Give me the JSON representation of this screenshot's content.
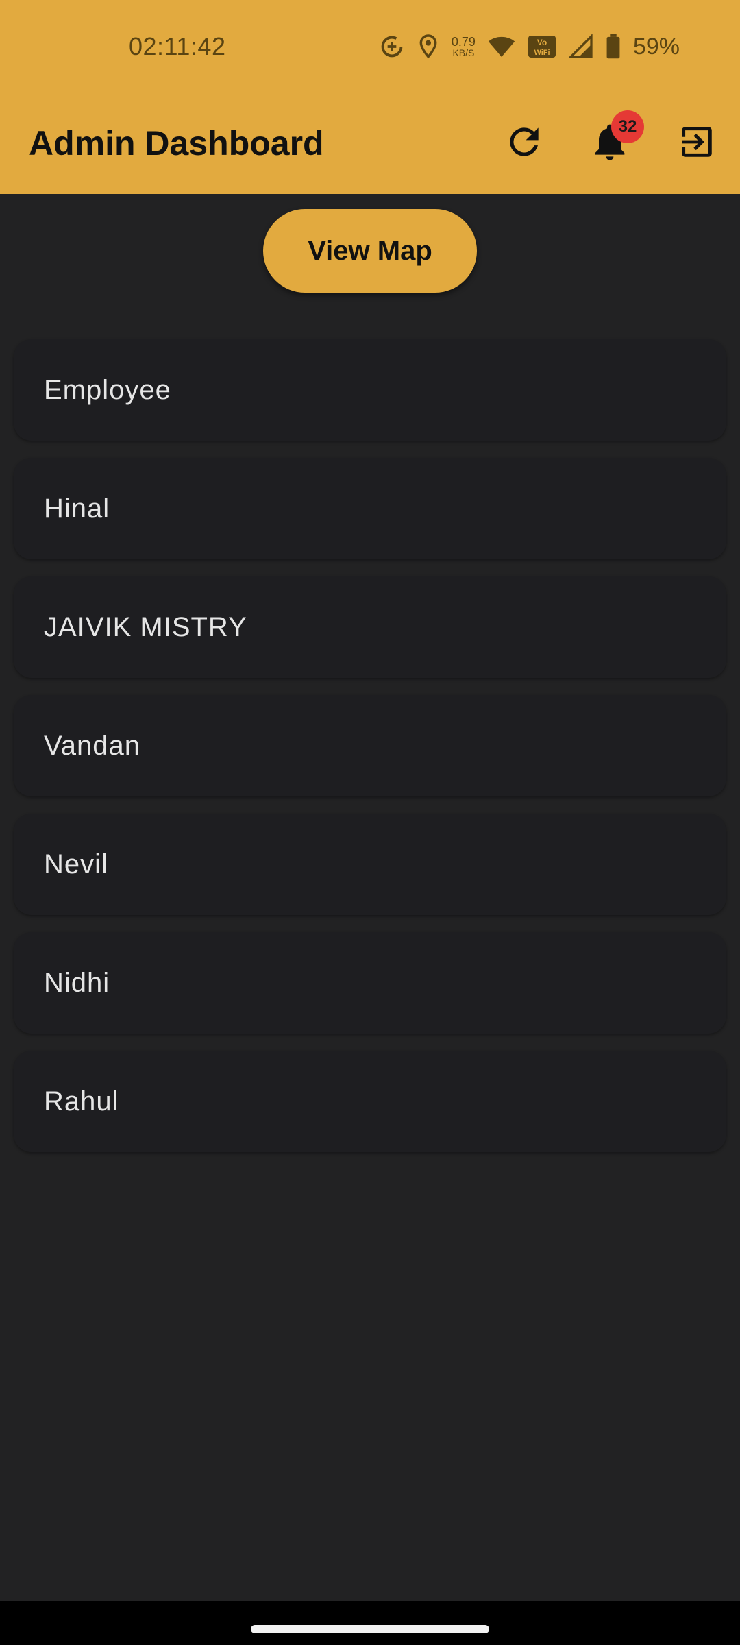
{
  "status_bar": {
    "time": "02:11:42",
    "net_speed_value": "0.79",
    "net_speed_unit": "KB/S",
    "wifi_badge": "Vo WiFi",
    "battery_percent": "59%"
  },
  "app_bar": {
    "title": "Admin Dashboard",
    "notification_count": "32",
    "accent_color": "#E2AA3F",
    "badge_color": "#E53935"
  },
  "view_map": {
    "label": "View Map"
  },
  "employees": [
    {
      "name": "Employee"
    },
    {
      "name": "Hinal"
    },
    {
      "name": "JAIVIK MISTRY"
    },
    {
      "name": "Vandan"
    },
    {
      "name": "Nevil"
    },
    {
      "name": "Nidhi"
    },
    {
      "name": "Rahul"
    }
  ],
  "icons": {
    "refresh": "refresh-icon",
    "notifications": "bell-icon",
    "logout": "logout-icon"
  }
}
